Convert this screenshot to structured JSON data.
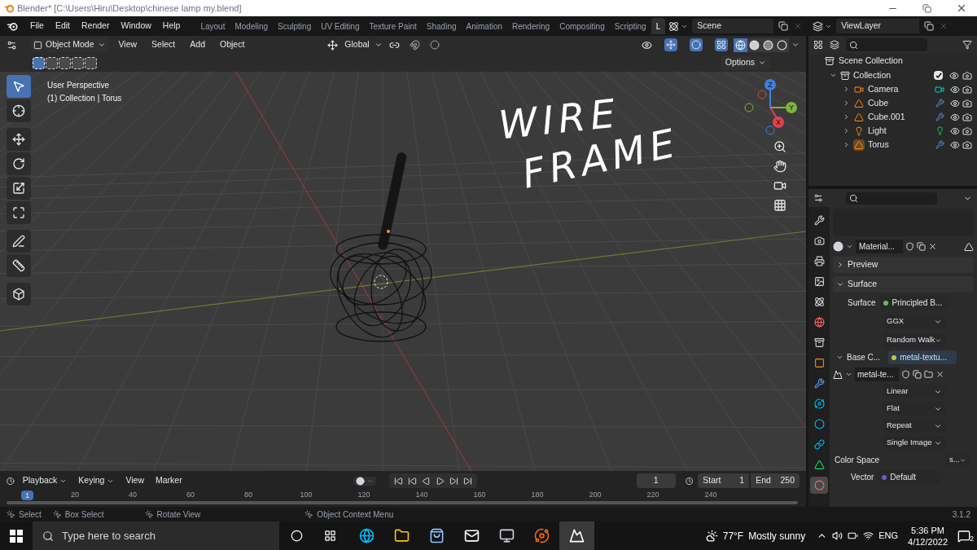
{
  "title_bar": {
    "title": "Blender* [C:\\Users\\Hiru\\Desktop\\chinese lamp my.blend]"
  },
  "menu": [
    "File",
    "Edit",
    "Render",
    "Window",
    "Help"
  ],
  "workspaces": [
    {
      "label": "Layout",
      "selected": false
    },
    {
      "label": "Modeling",
      "selected": false
    },
    {
      "label": "Sculpting",
      "selected": false
    },
    {
      "label": "UV Editing",
      "selected": false
    },
    {
      "label": "Texture Paint",
      "selected": false
    },
    {
      "label": "Shading",
      "selected": false
    },
    {
      "label": "Animation",
      "selected": false
    },
    {
      "label": "Rendering",
      "selected": false
    },
    {
      "label": "Compositing",
      "selected": false
    },
    {
      "label": "Scripting",
      "selected": false
    },
    {
      "label": "L",
      "selected": true
    }
  ],
  "scene": "Scene",
  "view_layer": "ViewLayer",
  "viewport": {
    "mode": "Object Mode",
    "menus": [
      "View",
      "Select",
      "Add",
      "Object"
    ],
    "orientation": "Global",
    "options": "Options",
    "shading": [
      {
        "kind": "wireframe",
        "selected": true
      },
      {
        "kind": "solid",
        "selected": false
      },
      {
        "kind": "material",
        "selected": false
      },
      {
        "kind": "rendered",
        "selected": false
      }
    ],
    "overlay_text": [
      "User Perspective",
      "(1) Collection | Torus"
    ],
    "annotation": [
      "WIRE",
      "FRAME"
    ],
    "gizmo": [
      "Z",
      "Y",
      "X"
    ],
    "tools": [
      {
        "kind": "select",
        "selected": true
      },
      {
        "kind": "cursor",
        "selected": false
      },
      {
        "kind": "move",
        "selected": false
      },
      {
        "kind": "rotate",
        "selected": false
      },
      {
        "kind": "scale",
        "selected": false
      },
      {
        "kind": "transform",
        "selected": false
      },
      {
        "kind": "annotate",
        "selected": false
      },
      {
        "kind": "measure",
        "selected": false
      },
      {
        "kind": "add_cube",
        "selected": false
      }
    ]
  },
  "outliner": {
    "root": "Scene Collection",
    "collection": {
      "name": "Collection",
      "checked": true,
      "expanded": true,
      "children": [
        {
          "name": "Camera",
          "kind": "camera",
          "selected": false
        },
        {
          "name": "Cube",
          "kind": "mesh",
          "selected": false
        },
        {
          "name": "Cube.001",
          "kind": "mesh",
          "selected": false
        },
        {
          "name": "Light",
          "kind": "light",
          "selected": false
        },
        {
          "name": "Torus",
          "kind": "mesh",
          "selected": true
        }
      ]
    }
  },
  "properties": {
    "tabs": [
      {
        "kind": "tool",
        "selected": false
      },
      {
        "kind": "render",
        "selected": false
      },
      {
        "kind": "output",
        "selected": false
      },
      {
        "kind": "view",
        "selected": false
      },
      {
        "kind": "scene",
        "selected": false
      },
      {
        "kind": "world",
        "selected": false
      },
      {
        "kind": "collection",
        "selected": false
      },
      {
        "kind": "object",
        "selected": false
      },
      {
        "kind": "modifier",
        "selected": false
      },
      {
        "kind": "particles",
        "selected": false
      },
      {
        "kind": "physics",
        "selected": false
      },
      {
        "kind": "constraints",
        "selected": false
      },
      {
        "kind": "data",
        "selected": false
      },
      {
        "kind": "material",
        "selected": true
      }
    ],
    "material": "Material...",
    "sections": [
      {
        "label": "Preview",
        "expanded": false
      },
      {
        "label": "Surface",
        "expanded": true
      }
    ],
    "surface": {
      "label": "Surface",
      "value": "Principled B...",
      "color": "#5dc35d"
    },
    "dropdowns": [
      "GGX",
      "Random Walk"
    ],
    "base_color": {
      "label": "Base C...",
      "value": "metal-textu...",
      "color": "#c7c729"
    },
    "image": "metal-te...",
    "image_dropdowns": [
      "Linear",
      "Flat",
      "Repeat",
      "Single Image"
    ],
    "color_space": {
      "label": "Color Space",
      "value": "s..."
    },
    "vector": {
      "label": "Vector",
      "value": "Default",
      "color": "#6363c7"
    }
  },
  "timeline": {
    "menus": [
      "Playback",
      "Keying",
      "View",
      "Marker"
    ],
    "current": "1",
    "start_label": "Start",
    "start": "1",
    "end_label": "End",
    "end": "250",
    "marker": "1",
    "ruler": [
      "20",
      "40",
      "60",
      "80",
      "100",
      "120",
      "140",
      "160",
      "180",
      "200",
      "220",
      "240"
    ]
  },
  "status_bar": {
    "items": [
      "Select",
      "Box Select",
      "Rotate View",
      "Object Context Menu"
    ],
    "version": "3.1.2"
  },
  "taskbar": {
    "search_placeholder": "Type here to search",
    "apps": [
      {
        "kind": "edge",
        "selected": false
      },
      {
        "kind": "explorer",
        "selected": false
      },
      {
        "kind": "store",
        "selected": false
      },
      {
        "kind": "mail",
        "selected": false
      },
      {
        "kind": "monitor",
        "selected": false
      },
      {
        "kind": "blender",
        "selected": false
      },
      {
        "kind": "photos",
        "selected": true
      }
    ],
    "temperature": "77°F",
    "weather": "Mostly sunny",
    "language": "ENG",
    "time": "5:36 PM",
    "date": "4/12/2022",
    "notifications": "2"
  }
}
